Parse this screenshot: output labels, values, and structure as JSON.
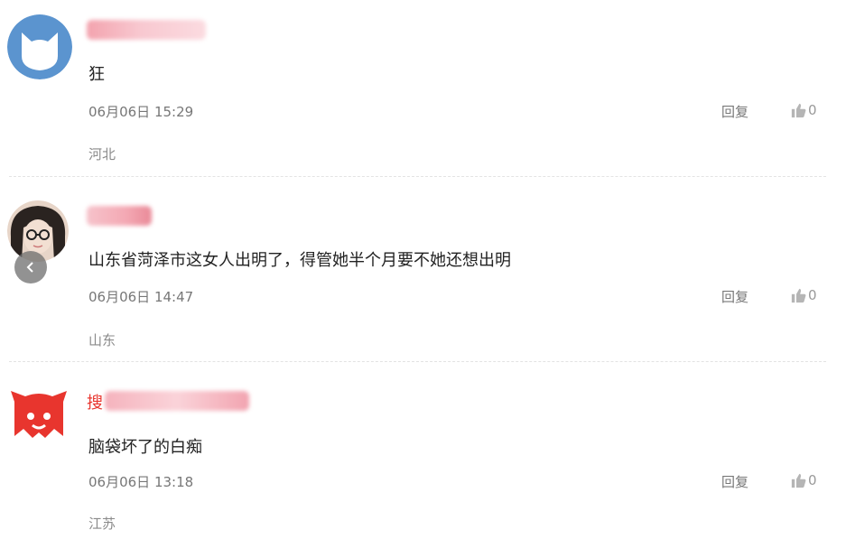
{
  "comments": [
    {
      "text": "狂",
      "time": "06月06日 15:29",
      "reply": "回复",
      "likes": "0",
      "location": "河北"
    },
    {
      "text": "山东省菏泽市这女人出明了，得管她半个月要不她还想出明",
      "time": "06月06日 14:47",
      "reply": "回复",
      "likes": "0",
      "location": "山东"
    },
    {
      "username_prefix": "搜",
      "text": "脑袋坏了的白痴",
      "time": "06月06日 13:18",
      "reply": "回复",
      "likes": "0",
      "location": "江苏"
    }
  ],
  "colors": {
    "blurred_name_pink": "#f4a9b4",
    "brand_red": "#e8352e",
    "avatar_blue": "#5b94cf"
  }
}
